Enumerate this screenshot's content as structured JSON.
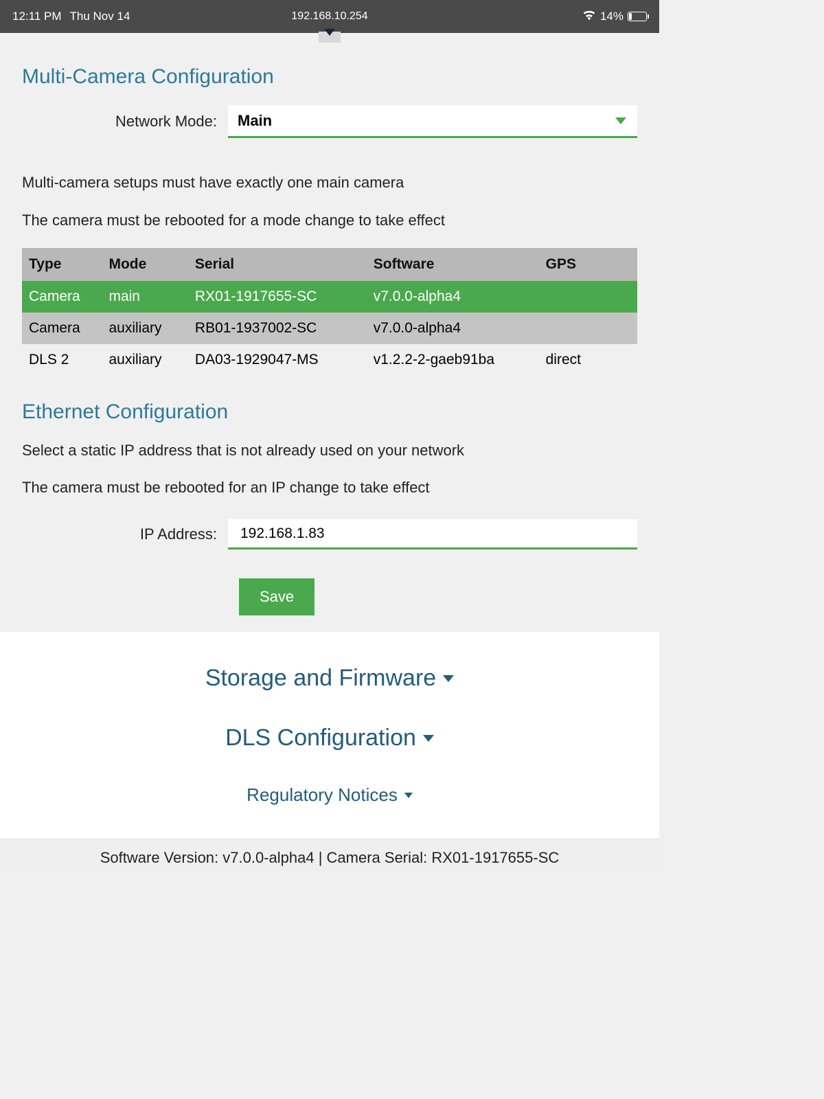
{
  "status_bar": {
    "time": "12:11 PM",
    "date": "Thu Nov 14",
    "url": "192.168.10.254",
    "battery_pct": "14%"
  },
  "multi_camera": {
    "title": "Multi-Camera Configuration",
    "network_mode_label": "Network Mode:",
    "network_mode_value": "Main",
    "info1": "Multi-camera setups must have exactly one main camera",
    "info2": "The camera must be rebooted for a mode change to take effect",
    "table": {
      "headers": [
        "Type",
        "Mode",
        "Serial",
        "Software",
        "GPS"
      ],
      "rows": [
        {
          "type": "Camera",
          "mode": "main",
          "serial": "RX01-1917655-SC",
          "software": "v7.0.0-alpha4",
          "gps": "",
          "highlight": "green"
        },
        {
          "type": "Camera",
          "mode": "auxiliary",
          "serial": "RB01-1937002-SC",
          "software": "v7.0.0-alpha4",
          "gps": "",
          "highlight": "gray"
        },
        {
          "type": "DLS 2",
          "mode": "auxiliary",
          "serial": "DA03-1929047-MS",
          "software": "v1.2.2-2-gaeb91ba",
          "gps": "direct",
          "highlight": "white"
        }
      ]
    }
  },
  "ethernet": {
    "title": "Ethernet Configuration",
    "info1": "Select a static IP address that is not already used on your network",
    "info2": "The camera must be rebooted for an IP change to take effect",
    "ip_label": "IP Address:",
    "ip_value": "192.168.1.83",
    "save_label": "Save"
  },
  "accordion": {
    "storage": "Storage and Firmware",
    "dls": "DLS Configuration",
    "regulatory": "Regulatory Notices"
  },
  "footer": {
    "text": "Software Version: v7.0.0-alpha4 | Camera Serial: RX01-1917655-SC"
  }
}
